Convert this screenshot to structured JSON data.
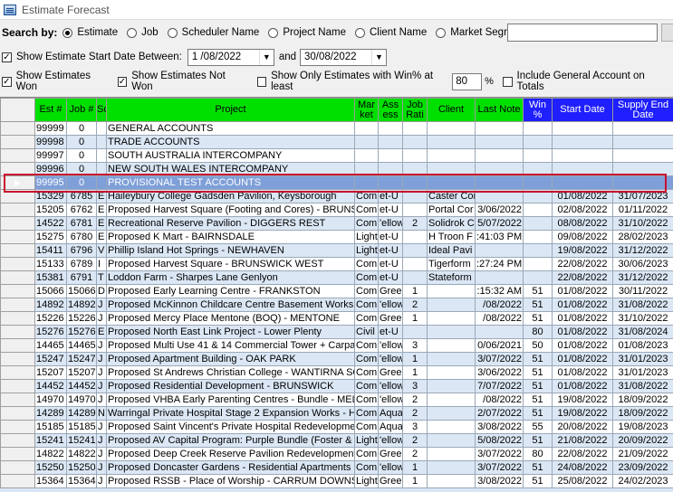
{
  "window": {
    "title": "Estimate Forecast"
  },
  "search": {
    "label": "Search by:",
    "options": [
      "Estimate",
      "Job",
      "Scheduler Name",
      "Project Name",
      "Client Name",
      "Market Segment"
    ],
    "selected": "Estimate",
    "text_value": ""
  },
  "filters": {
    "start_between_label": "Show Estimate Start Date Between:",
    "start_from": "1 /08/2022",
    "and_label": "and",
    "start_to": "30/08/2022",
    "show_won_label": "Show Estimates Won",
    "show_not_won_label": "Show Estimates Not Won",
    "only_winpct_label": "Show Only Estimates with Win% at least",
    "winpct_value": "80",
    "pct_label": "%",
    "include_general_label": "Include General Account on Totals"
  },
  "grid": {
    "columns": [
      "Est #",
      "Job #",
      "Sc",
      "Project",
      "Mar ket",
      "Ass ess",
      "Job Rati",
      "Client",
      "Last Note",
      "Win %",
      "Start Date",
      "Supply End Date"
    ],
    "rows": [
      [
        "99999",
        "0",
        "",
        "GENERAL ACCOUNTS",
        "",
        "",
        "",
        "",
        "",
        "",
        "",
        ""
      ],
      [
        "99998",
        "0",
        "",
        "TRADE ACCOUNTS",
        "",
        "",
        "",
        "",
        "",
        "",
        "",
        ""
      ],
      [
        "99997",
        "0",
        "",
        "SOUTH AUSTRALIA INTERCOMPANY",
        "",
        "",
        "",
        "",
        "",
        "",
        "",
        ""
      ],
      [
        "99996",
        "0",
        "",
        "NEW SOUTH WALES INTERCOMPANY",
        "",
        "",
        "",
        "",
        "",
        "",
        "",
        ""
      ],
      [
        "99995",
        "0",
        "",
        "PROVISIONAL TEST ACCOUNTS",
        "",
        "",
        "",
        "",
        "",
        "",
        "",
        ""
      ],
      [
        "15329",
        "6785",
        "E",
        "Haileybury College Gadsden Pavilion, Keysborough",
        "Com",
        "et-U",
        "",
        "Caster Cor",
        "",
        "",
        "01/08/2022",
        "31/07/2023"
      ],
      [
        "15205",
        "6762",
        "E",
        "Proposed Harvest Square (Footing and Cores) - BRUNSW",
        "Com",
        "et-U",
        "",
        "Portal Cor",
        "3/06/2022",
        "",
        "02/08/2022",
        "01/11/2022"
      ],
      [
        "14522",
        "6781",
        "E",
        "Recreational Reserve Pavilion - DIGGERS REST",
        "Com",
        "'ellow",
        "2",
        "Solidrok C",
        "5/07/2022",
        "",
        "08/08/2022",
        "31/10/2022"
      ],
      [
        "15275",
        "6780",
        "E",
        "Proposed K Mart - BAIRNSDALE",
        "Light",
        "et-U",
        "",
        "H Troon F",
        ":41:03 PM",
        "",
        "09/08/2022",
        "28/02/2023"
      ],
      [
        "15411",
        "6796",
        "V",
        "Phillip Island Hot Springs - NEWHAVEN",
        "Light",
        "et-U",
        "",
        "Ideal Pavi",
        "",
        "",
        "19/08/2022",
        "31/12/2022"
      ],
      [
        "15133",
        "6789",
        "I",
        "Proposed Harvest Square - BRUNSWICK WEST",
        "Com",
        "et-U",
        "",
        "Tigerform",
        ":27:24 PM",
        "",
        "22/08/2022",
        "30/06/2023"
      ],
      [
        "15381",
        "6791",
        "T",
        "Loddon Farm - Sharpes Lane Genlyon",
        "Com",
        "et-U",
        "",
        "Stateform",
        "",
        "",
        "22/08/2022",
        "31/12/2022"
      ],
      [
        "15066",
        "15066",
        "D",
        "Proposed Early Learning Centre - FRANKSTON",
        "Com",
        "Green",
        "1",
        "",
        ":15:32 AM",
        "51",
        "01/08/2022",
        "30/11/2022"
      ],
      [
        "14892",
        "14892",
        "J",
        "Proposed McKinnon Childcare Centre Basement Works -",
        "Com",
        "'ellow",
        "2",
        "",
        "/08/2022",
        "51",
        "01/08/2022",
        "31/08/2022"
      ],
      [
        "15226",
        "15226",
        "J",
        "Proposed Mercy Place Mentone (BOQ) - MENTONE",
        "Com",
        "Green",
        "1",
        "",
        "/08/2022",
        "51",
        "01/08/2022",
        "31/10/2022"
      ],
      [
        "15276",
        "15276",
        "E",
        "Proposed North East Link Project - Lower Plenty",
        "Civil",
        "et-U",
        "",
        "",
        "",
        "80",
        "01/08/2022",
        "31/08/2024"
      ],
      [
        "14465",
        "14465",
        "J",
        "Proposed Multi Use 41 & 14 Commercial Tower + Carpark",
        "Com",
        "'ellow",
        "3",
        "",
        "0/06/2021",
        "50",
        "01/08/2022",
        "01/08/2023"
      ],
      [
        "15247",
        "15247",
        "J",
        "Proposed Apartment Building - OAK PARK",
        "Com",
        "'ellow",
        "1",
        "",
        "3/07/2022",
        "51",
        "01/08/2022",
        "31/01/2023"
      ],
      [
        "15207",
        "15207",
        "J",
        "Proposed St Andrews Christian College - WANTIRNA SO",
        "Com",
        "Green",
        "1",
        "",
        "3/06/2022",
        "51",
        "01/08/2022",
        "31/01/2023"
      ],
      [
        "14452",
        "14452",
        "J",
        "Proposed Residential Development - BRUNSWICK",
        "Com",
        "'ellow",
        "3",
        "",
        "7/07/2022",
        "51",
        "01/08/2022",
        "31/08/2022"
      ],
      [
        "14970",
        "14970",
        "J",
        "Proposed VHBA Early Parenting Centres - Bundle - MELE",
        "Com",
        "'ellow",
        "2",
        "",
        "/08/2022",
        "51",
        "19/08/2022",
        "18/09/2022"
      ],
      [
        "14289",
        "14289",
        "N",
        "Warringal Private Hospital Stage 2 Expansion Works - HE",
        "Com",
        "Aqua",
        "2",
        "",
        "2/07/2022",
        "51",
        "19/08/2022",
        "18/09/2022"
      ],
      [
        "15185",
        "15185",
        "J",
        "Proposed Saint Vincent's Private Hospital Redevelopmen",
        "Com",
        "Aqua",
        "3",
        "",
        "3/08/2022",
        "55",
        "20/08/2022",
        "19/08/2023"
      ],
      [
        "15241",
        "15241",
        "J",
        "Proposed AV Capital Program: Purple Bundle (Foster & Gi",
        "Light",
        "'ellow",
        "2",
        "",
        "5/08/2022",
        "51",
        "21/08/2022",
        "20/09/2022"
      ],
      [
        "14822",
        "14822",
        "J",
        "Proposed Deep Creek Reserve Pavilion Redevelopment",
        "Com",
        "Green",
        "2",
        "",
        "3/07/2022",
        "80",
        "22/08/2022",
        "21/09/2022"
      ],
      [
        "15250",
        "15250",
        "J",
        "Proposed Doncaster Gardens - Residential Apartments - I",
        "Com",
        "'ellow",
        "1",
        "",
        "3/07/2022",
        "51",
        "24/08/2022",
        "23/09/2022"
      ],
      [
        "15364",
        "15364",
        "J",
        "Proposed RSSB - Place of Worship - CARRUM DOWNS",
        "Light",
        "Green",
        "1",
        "",
        "3/08/2022",
        "51",
        "25/08/2022",
        "24/02/2023"
      ]
    ],
    "selected_index": 4
  }
}
